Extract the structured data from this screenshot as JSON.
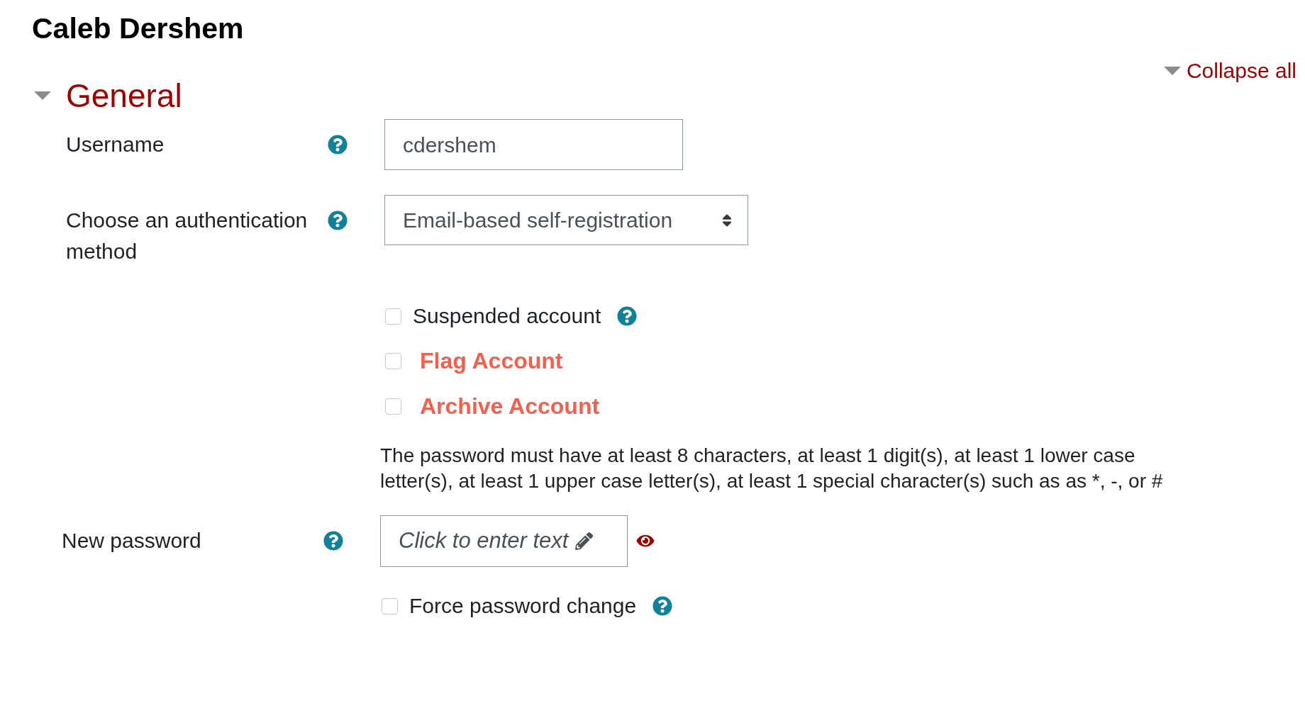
{
  "page_title": "Caleb Dershem",
  "collapse_all": "Collapse all",
  "section": {
    "title": "General",
    "expanded": true,
    "fields": [
      {
        "kind": "text",
        "label": "Username",
        "help": true,
        "value": "cdershem"
      },
      {
        "kind": "select",
        "label": "Choose an authentication method",
        "help": true,
        "value": "Email-based self-registration"
      },
      {
        "kind": "checkbox",
        "label": "Suspended account",
        "checked": false,
        "help": true
      },
      {
        "kind": "warning_checkbox",
        "label": "Flag Account",
        "checked": false,
        "help": false
      },
      {
        "kind": "warning_checkbox",
        "label": "Archive Account",
        "checked": false,
        "help": false
      },
      {
        "kind": "note",
        "text": "The password must have at least 8 characters, at least 1 digit(s), at least 1 lower case letter(s), at least 1 upper case letter(s), at least 1 special character(s) such as as *, -, or #"
      },
      {
        "kind": "password",
        "label": "New password",
        "help": true,
        "placeholder": "Click to enter text"
      },
      {
        "kind": "checkbox",
        "label": "Force password change",
        "checked": false,
        "help": true
      }
    ]
  }
}
